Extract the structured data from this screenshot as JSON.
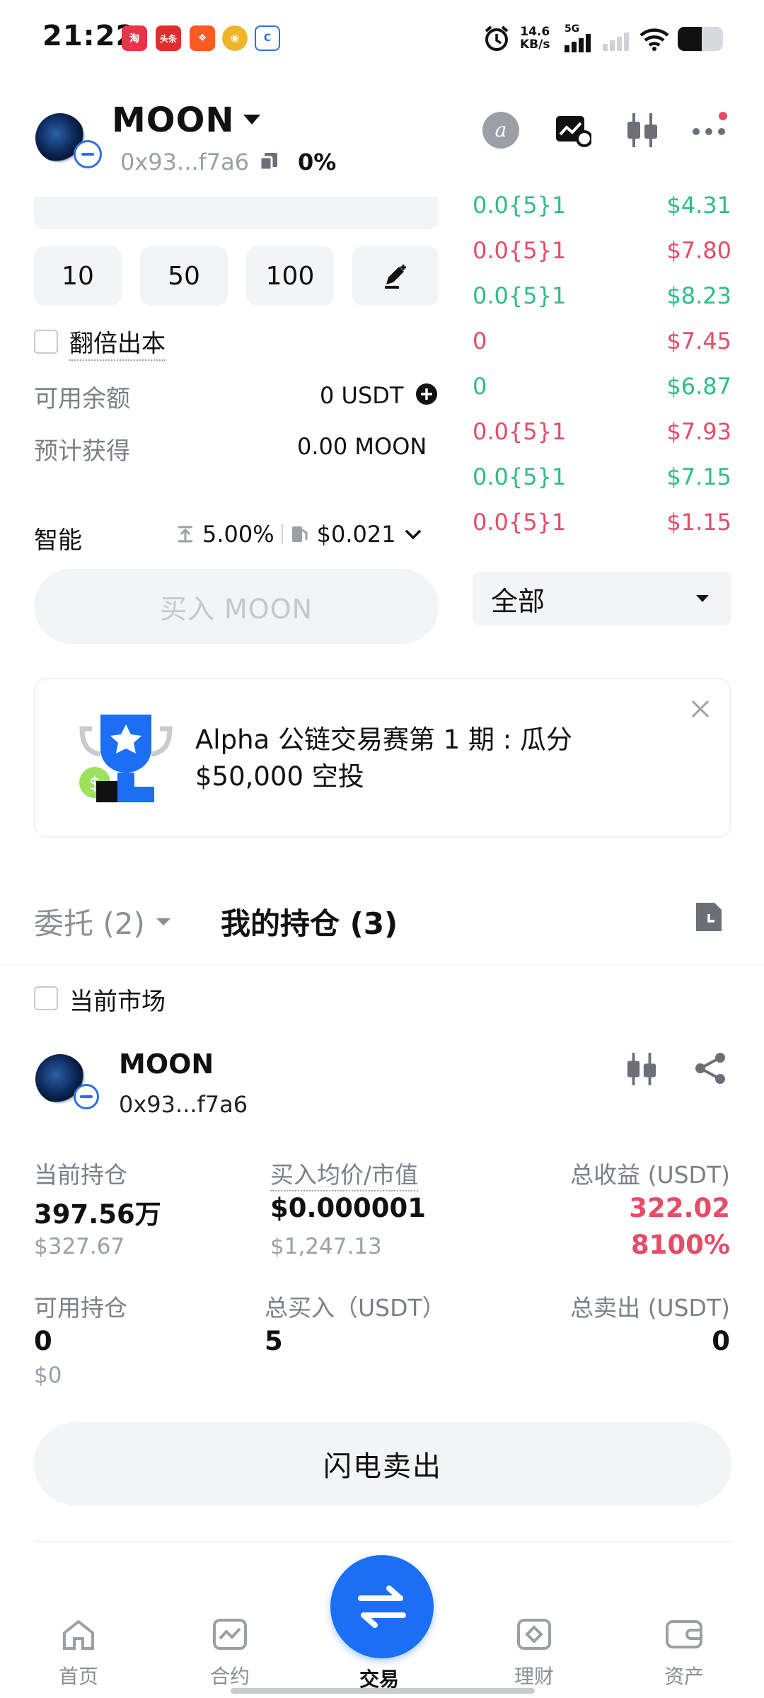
{
  "status_bar": {
    "time": "21:22",
    "speed_value": "14.6",
    "speed_unit": "KB/s",
    "network": "5G"
  },
  "header": {
    "token_name": "MOON",
    "token_address": "0x93...f7a6",
    "change_pct": "0%"
  },
  "trade_form": {
    "amount_presets": [
      "10",
      "50",
      "100"
    ],
    "double_principal_label": "翻倍出本",
    "available_label": "可用余额",
    "available_value": "0 USDT",
    "estimated_label": "预计获得",
    "estimated_value": "0.00 MOON",
    "mode_label": "智能",
    "slippage": "5.00%",
    "gas": "$0.021",
    "buy_button": "买入 MOON"
  },
  "order_book": {
    "rows": [
      {
        "price": "0.0{5}1",
        "amount": "$4.31",
        "side": "buy"
      },
      {
        "price": "0.0{5}1",
        "amount": "$7.80",
        "side": "sell"
      },
      {
        "price": "0.0{5}1",
        "amount": "$8.23",
        "side": "buy"
      },
      {
        "price": "0",
        "amount": "$7.45",
        "side": "sell"
      },
      {
        "price": "0",
        "amount": "$6.87",
        "side": "buy"
      },
      {
        "price": "0.0{5}1",
        "amount": "$7.93",
        "side": "sell"
      },
      {
        "price": "0.0{5}1",
        "amount": "$7.15",
        "side": "buy"
      },
      {
        "price": "0.0{5}1",
        "amount": "$1.15",
        "side": "sell"
      }
    ],
    "filter_value": "全部"
  },
  "banner": {
    "line1": "Alpha 公链交易赛第 1 期 : 瓜分",
    "line2": "$50,000 空投"
  },
  "tabs": {
    "orders_label": "委托 (2)",
    "positions_label": "我的持仓 (3)"
  },
  "current_market_label": "当前市场",
  "position": {
    "name": "MOON",
    "address": "0x93...f7a6",
    "holding_label": "当前持仓",
    "holding_value": "397.56万",
    "holding_usd": "$327.67",
    "avg_label": "买入均价/市值",
    "avg_value": "$0.000001",
    "market_value": "$1,247.13",
    "pnl_label": "总收益 (USDT)",
    "pnl_value": "322.02",
    "pnl_pct": "8100%",
    "avail_label": "可用持仓",
    "avail_value": "0",
    "avail_usd": "$0",
    "total_buy_label": "总买入（USDT）",
    "total_buy_value": "5",
    "total_sell_label": "总卖出 (USDT)",
    "total_sell_value": "0",
    "flash_sell": "闪电卖出"
  },
  "nav": {
    "home": "首页",
    "contract": "合约",
    "trade": "交易",
    "finance": "理财",
    "assets": "资产"
  },
  "colors": {
    "green": "#2ebd85",
    "red": "#e54c67",
    "accent": "#1b6ff5"
  }
}
